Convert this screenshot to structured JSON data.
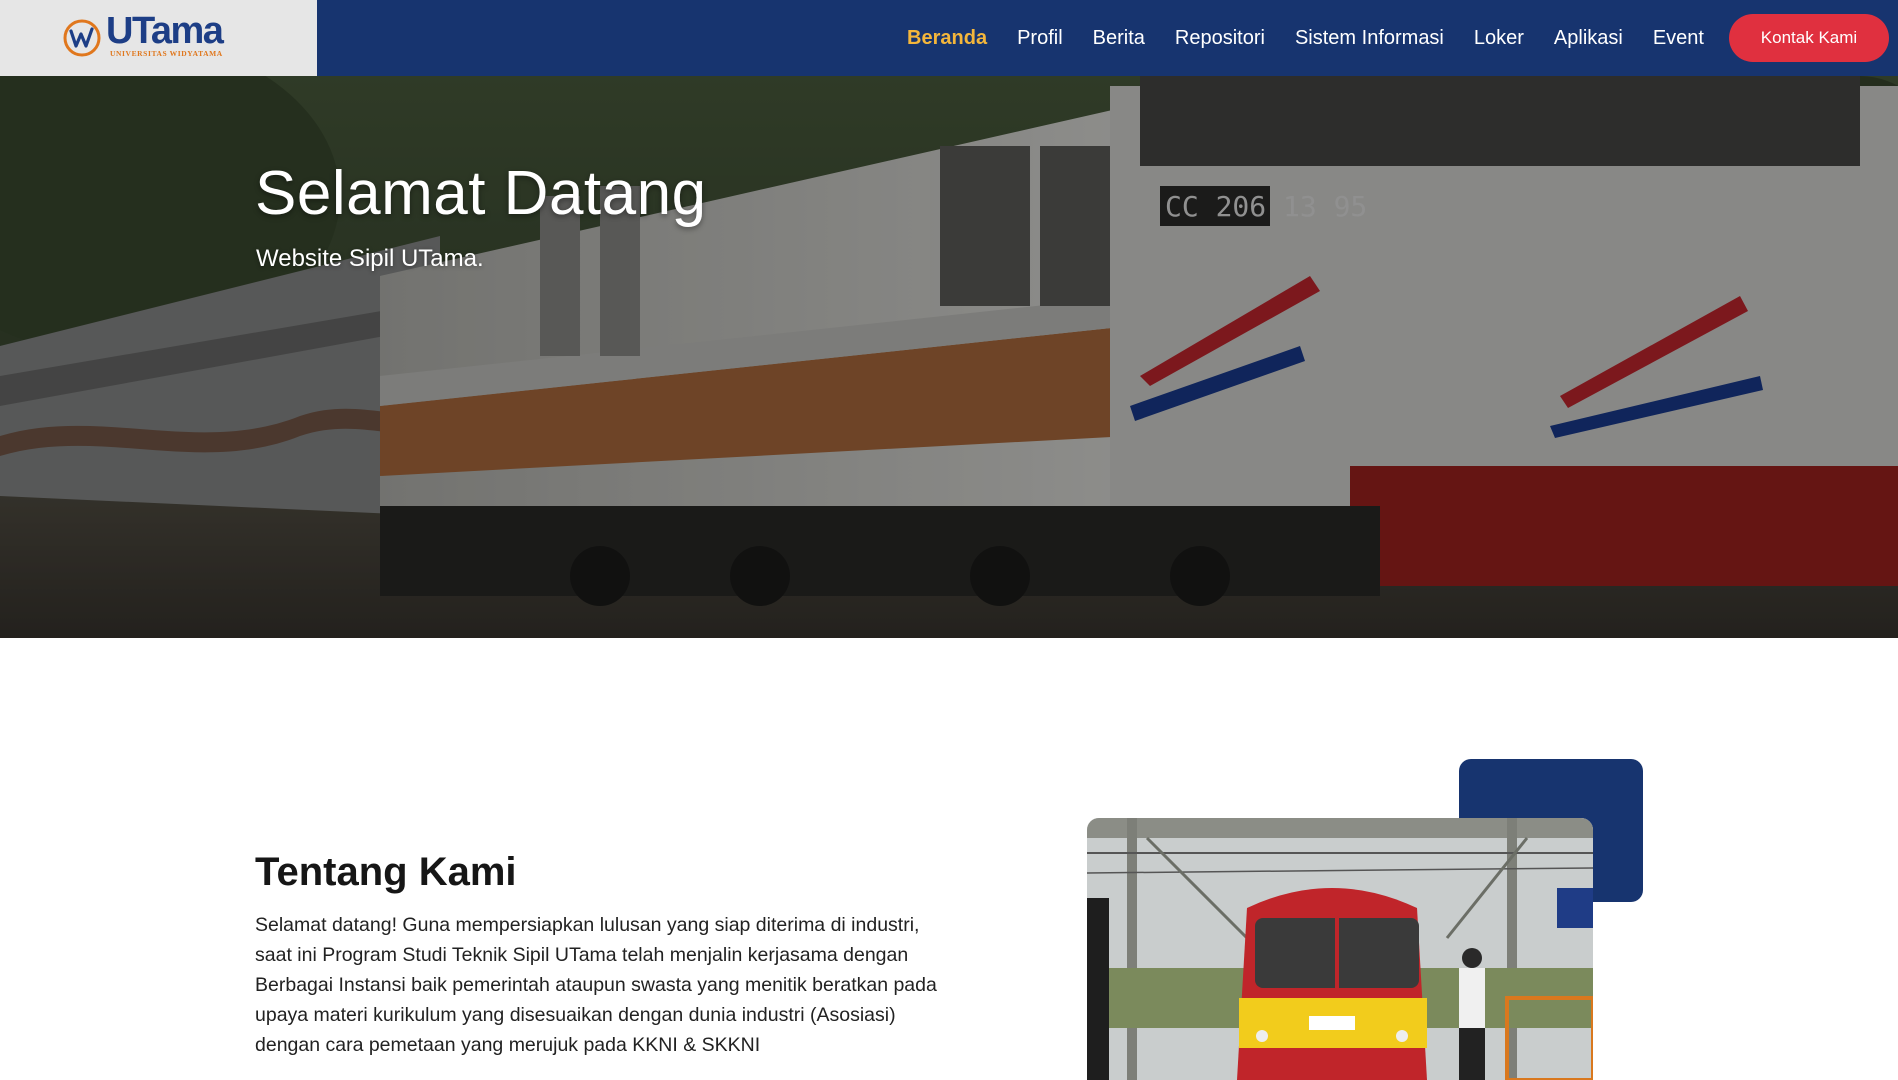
{
  "header": {
    "logo_text": "UTama",
    "logo_sub": "UNIVERSITAS WIDYATAMA",
    "nav": [
      {
        "label": "Beranda",
        "active": true
      },
      {
        "label": "Profil"
      },
      {
        "label": "Berita"
      },
      {
        "label": "Repositori"
      },
      {
        "label": "Sistem Informasi"
      },
      {
        "label": "Loker"
      },
      {
        "label": "Aplikasi"
      },
      {
        "label": "Event"
      }
    ],
    "contact_label": "Kontak Kami"
  },
  "hero": {
    "title": "Selamat Datang",
    "subtitle": "Website Sipil UTama.",
    "locomotive_number": "CC 206 13 95"
  },
  "about": {
    "title": "Tentang Kami",
    "text": "Selamat datang! Guna mempersiapkan lulusan yang siap diterima di industri, saat ini Program Studi Teknik Sipil UTama telah menjalin kerjasama dengan Berbagai Instansi baik pemerintah ataupun swasta yang menitik beratkan pada upaya materi kurikulum yang disesuaikan dengan dunia industri (Asosiasi) dengan cara pemetaan yang merujuk pada KKNI & SKKNI"
  },
  "colors": {
    "primary": "#17346f",
    "accent": "#f4b63b",
    "button": "#e0303f"
  }
}
